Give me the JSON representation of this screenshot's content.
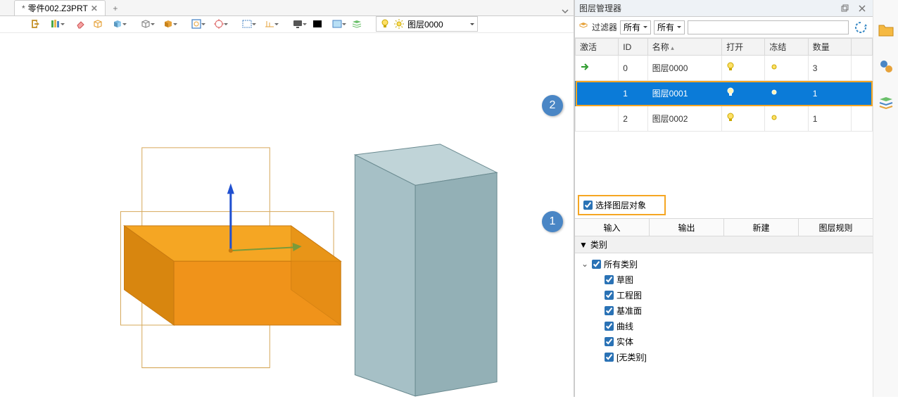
{
  "tab": {
    "dirty_marker": "*",
    "title": "零件002.Z3PRT",
    "close": "✕",
    "add": "+"
  },
  "toolbar": {
    "layer_dd": {
      "name": "图层0000"
    }
  },
  "panel": {
    "title": "图层管理器",
    "filter_label": "过滤器",
    "filter_opt1": "所有",
    "filter_opt2": "所有",
    "headers": {
      "active": "激活",
      "id": "ID",
      "name": "名称",
      "open": "打开",
      "freeze": "冻结",
      "count": "数量"
    },
    "rows": [
      {
        "active": true,
        "id": "0",
        "name": "图层0000",
        "open": true,
        "frozen": false,
        "count": "3",
        "selected": false
      },
      {
        "active": false,
        "id": "1",
        "name": "图层0001",
        "open": true,
        "frozen": false,
        "count": "1",
        "selected": true
      },
      {
        "active": false,
        "id": "2",
        "name": "图层0002",
        "open": true,
        "frozen": false,
        "count": "1",
        "selected": false
      }
    ],
    "select_objects": "选择图层对象",
    "buttons": {
      "import": "输入",
      "export": "输出",
      "new": "新建",
      "rule": "图层规则"
    },
    "category_header": "类别",
    "tree": {
      "root": "所有类别",
      "items": [
        "草图",
        "工程图",
        "基准面",
        "曲线",
        "实体",
        "[无类别]"
      ]
    }
  },
  "callouts": {
    "one": "1",
    "two": "2"
  },
  "colors": {
    "accent": "#0b7bd8",
    "highlight": "#f5a623"
  }
}
